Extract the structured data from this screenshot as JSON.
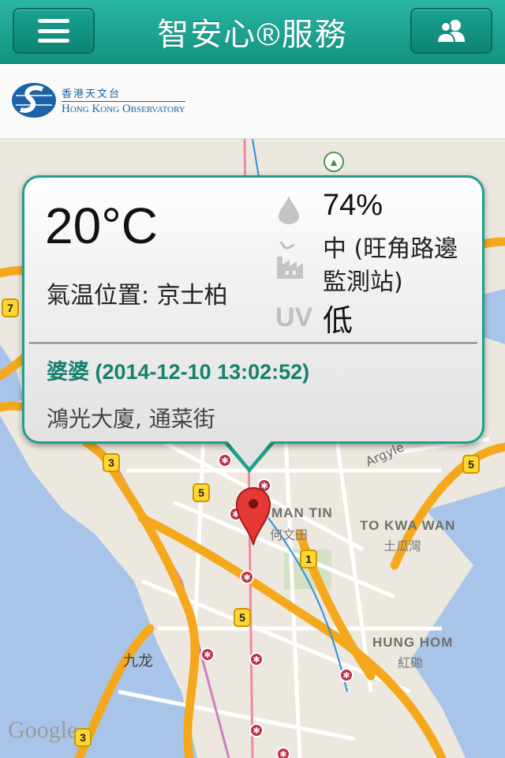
{
  "header": {
    "title": "智安心®服務",
    "menu_icon": "menu-icon",
    "contacts_icon": "contacts-icon"
  },
  "logo": {
    "zh": "香港天文台",
    "en": "Hong Kong Observatory"
  },
  "popup": {
    "temperature": "20°C",
    "temperature_location": "氣温位置: 京士柏",
    "humidity": "74%",
    "air_quality": "中 (旺角路邊監測站)",
    "uv_icon_label": "UV",
    "uv_level": "低",
    "person": "婆婆 (2014-12-10 13:02:52)",
    "address": "鴻光大廈, 通菜街"
  },
  "map": {
    "labels": {
      "man_tin": "MAN TIN",
      "man_tin_zh": "何文田",
      "to_kwa_wan": "TO KWA WAN",
      "to_kwa_wan_zh": "土瓜灣",
      "hung_hom": "HUNG HOM",
      "hung_hom_zh": "紅磡",
      "kowloon_zh": "九龙",
      "argyle": "Argyle"
    },
    "routes": [
      "7",
      "3",
      "5",
      "5",
      "1",
      "5",
      "3"
    ],
    "attribution": "Google"
  },
  "colors": {
    "header": "#16a08e",
    "accent": "#20a08c",
    "water": "#a6c4e8",
    "land": "#e9e5dc",
    "road_major": "#f6a81c"
  }
}
